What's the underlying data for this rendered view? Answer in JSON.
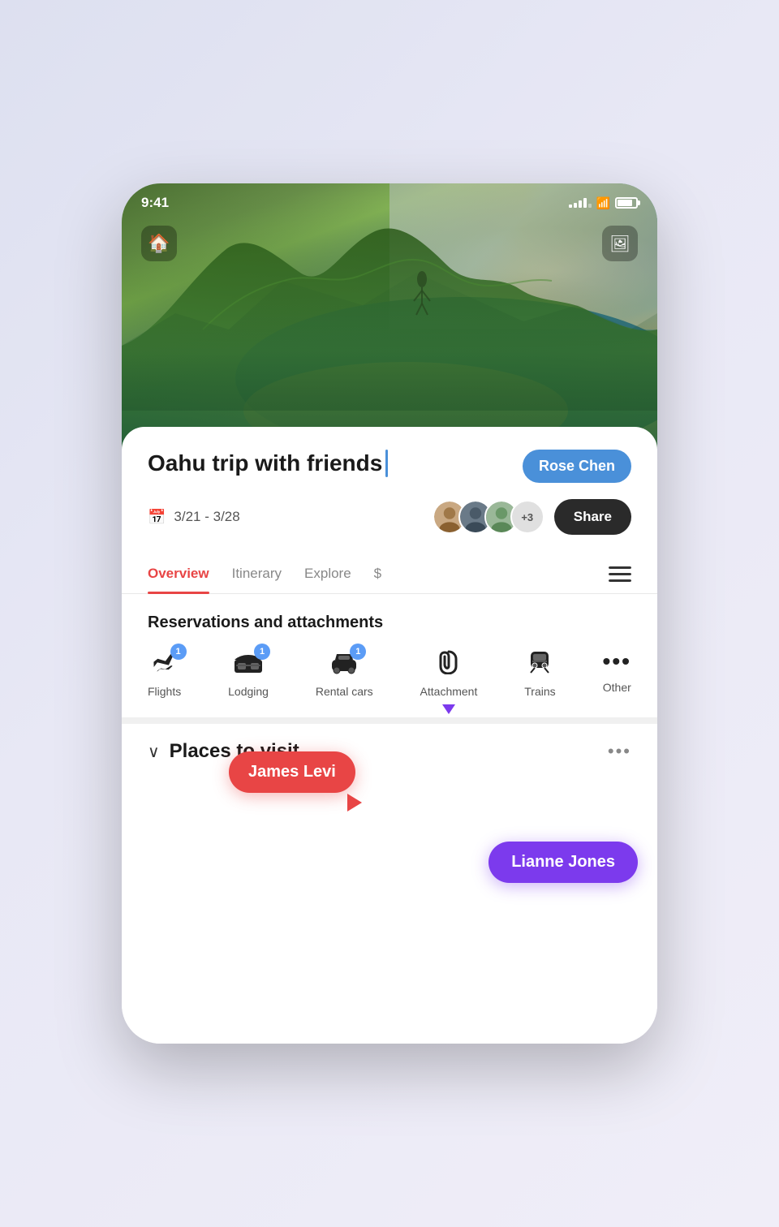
{
  "page": {
    "background": "#dde0f0"
  },
  "statusBar": {
    "time": "9:41",
    "signalBars": [
      4,
      6,
      8,
      10,
      12
    ],
    "batteryPercent": 80
  },
  "header": {
    "homeIcon": "🏠",
    "photoIcon": "🖼"
  },
  "trip": {
    "title": "Oahu trip with friends",
    "dateRange": "3/21 - 3/28",
    "shareLabel": "Share",
    "avatarCount": "+3"
  },
  "tabs": [
    {
      "label": "Overview",
      "active": true
    },
    {
      "label": "Itinerary",
      "active": false
    },
    {
      "label": "Explore",
      "active": false
    },
    {
      "label": "$",
      "active": false
    }
  ],
  "reservations": {
    "sectionTitle": "Reservations and attachments",
    "items": [
      {
        "icon": "✈",
        "label": "Flights",
        "badge": "1"
      },
      {
        "icon": "🛏",
        "label": "Lodging",
        "badge": "1"
      },
      {
        "icon": "🚗",
        "label": "Rental cars",
        "badge": "1"
      },
      {
        "icon": "📎",
        "label": "Attachment",
        "badge": null
      },
      {
        "icon": "🚌",
        "label": "Trains",
        "badge": null
      },
      {
        "icon": "•••",
        "label": "Other",
        "badge": null
      }
    ]
  },
  "places": {
    "sectionTitle": "Places to visit"
  },
  "annotations": {
    "roseChen": "Rose Chen",
    "jamesLevi": "James Levi",
    "lianneJones": "Lianne Jones"
  }
}
